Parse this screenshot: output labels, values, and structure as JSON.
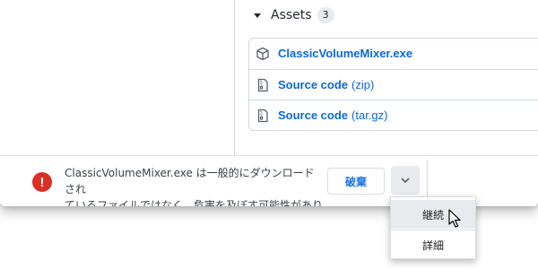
{
  "release": {
    "assets_title": "Assets",
    "assets_count": "3",
    "assets": [
      {
        "name": "ClassicVolumeMixer.exe",
        "suffix": "",
        "icon": "package-icon"
      },
      {
        "name": "Source code",
        "suffix": "(zip)",
        "icon": "file-zip-icon"
      },
      {
        "name": "Source code",
        "suffix": "(tar.gz)",
        "icon": "file-zip-icon"
      }
    ]
  },
  "download_bar": {
    "warning_line1": "ClassicVolumeMixer.exe は一般的にダウンロードされ",
    "warning_line2": "ているファイルではなく、危害を及ぼす可能性があります。",
    "discard_label": "破棄",
    "menu_icon": "chevron-down-icon",
    "warning_icon": "error-icon"
  },
  "context_menu": {
    "items": [
      {
        "label": "継続"
      },
      {
        "label": "詳細"
      }
    ]
  },
  "colors": {
    "link": "#0969da",
    "warning": "#d93025",
    "accent": "#1a73e8"
  }
}
